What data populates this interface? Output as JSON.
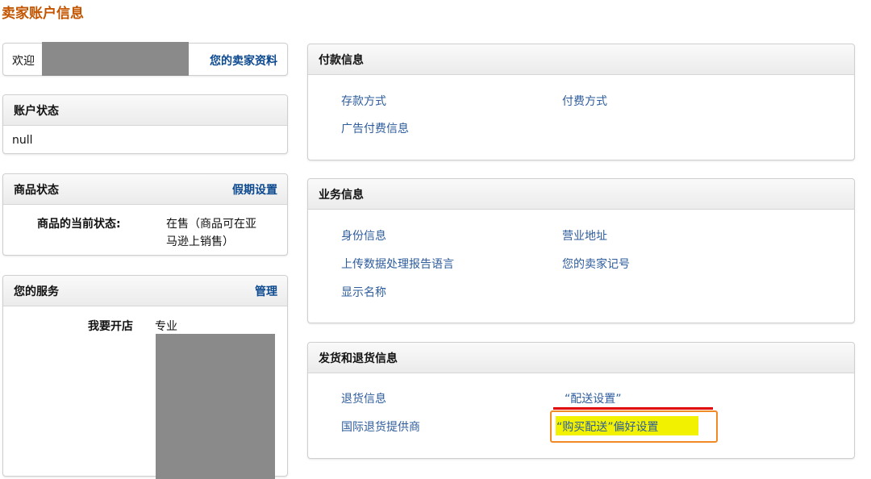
{
  "page": {
    "title": "卖家账户信息"
  },
  "welcome": {
    "label": "欢迎",
    "profile_link": "您的卖家资料"
  },
  "account_status": {
    "title": "账户状态",
    "value": "null"
  },
  "listing_status": {
    "title": "商品状态",
    "action": "假期设置",
    "current_label": "商品的当前状态:",
    "current_value_line1": "在售（商品可在亚",
    "current_value_line2": "马逊上销售）"
  },
  "services": {
    "title": "您的服务",
    "action": "管理",
    "row_label": "我要开店",
    "row_value": "专业"
  },
  "payment": {
    "title": "付款信息",
    "links": [
      "存款方式",
      "付费方式",
      "广告付费信息"
    ]
  },
  "business": {
    "title": "业务信息",
    "links": [
      "身份信息",
      "营业地址",
      "上传数据处理报告语言",
      "您的卖家记号",
      "显示名称"
    ]
  },
  "shipping": {
    "title": "发货和退货信息",
    "links": [
      "退货信息",
      "“配送设置”",
      "国际退货提供商",
      "“购买配送”偏好设置"
    ]
  },
  "colors": {
    "title": "#c45500",
    "link": "#2e5c9c",
    "highlight_fill": "#f2f200",
    "highlight_border": "#f08a24",
    "underline": "#e00000"
  }
}
